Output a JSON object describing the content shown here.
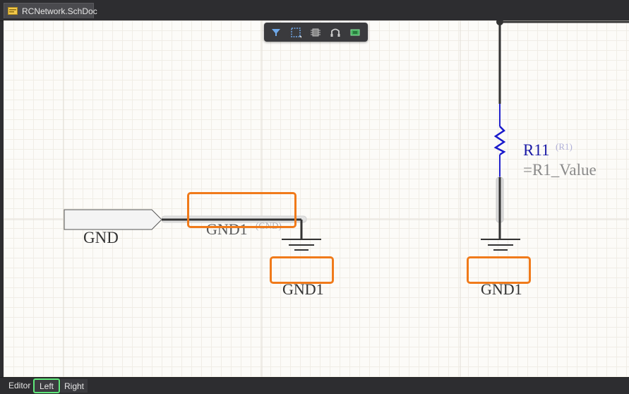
{
  "document_tab": {
    "label": "RCNetwork.SchDoc"
  },
  "toolbar": {
    "buttons": [
      {
        "name": "filter-icon"
      },
      {
        "name": "select-rect-icon"
      },
      {
        "name": "component-icon"
      },
      {
        "name": "wire-icon"
      },
      {
        "name": "place-icon"
      }
    ]
  },
  "schematic": {
    "port": {
      "label": "GND"
    },
    "net_label": {
      "name": "GND1",
      "sup": "(GND)"
    },
    "ground_1": {
      "label": "GND1"
    },
    "ground_2": {
      "label": "GND1"
    },
    "resistor": {
      "designator": "R11",
      "sup": "(R1)",
      "value": "=R1_Value"
    }
  },
  "bottom_bar": {
    "editor_label": "Editor",
    "tabs": [
      {
        "label": "Left",
        "active": true
      },
      {
        "label": "Right",
        "active": false
      }
    ]
  },
  "colors": {
    "highlight": "#f07a1a",
    "active_tab_outline": "#5fe87a",
    "resistor_blue": "#1a1aa6",
    "wire": "#333333"
  }
}
